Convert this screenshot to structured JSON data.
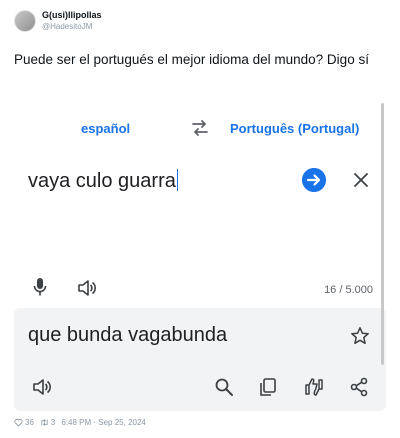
{
  "tweet": {
    "display_name": "G(usi)llipollas",
    "handle": "@HadesitoJM",
    "text": "Puede ser el portugués el mejor idioma del mundo? Digo sí",
    "likes": "36",
    "retweets": "3",
    "timestamp": "6:48 PM · Sep 25, 2024"
  },
  "translate": {
    "source_lang": "español",
    "target_lang": "Português (Portugal)",
    "source_text": "vaya culo guarra",
    "target_text": "que bunda vagabunda",
    "char_count": "16 / 5.000",
    "accent_color": "#1a73e8",
    "output_bg": "#f1f3f4"
  },
  "icons": [
    "swap-icon",
    "arrow-right-icon",
    "close-icon",
    "mic-icon",
    "speaker-icon",
    "star-icon",
    "search-icon",
    "copy-icon",
    "feedback-icon",
    "share-icon",
    "heart-icon",
    "retweet-icon"
  ]
}
